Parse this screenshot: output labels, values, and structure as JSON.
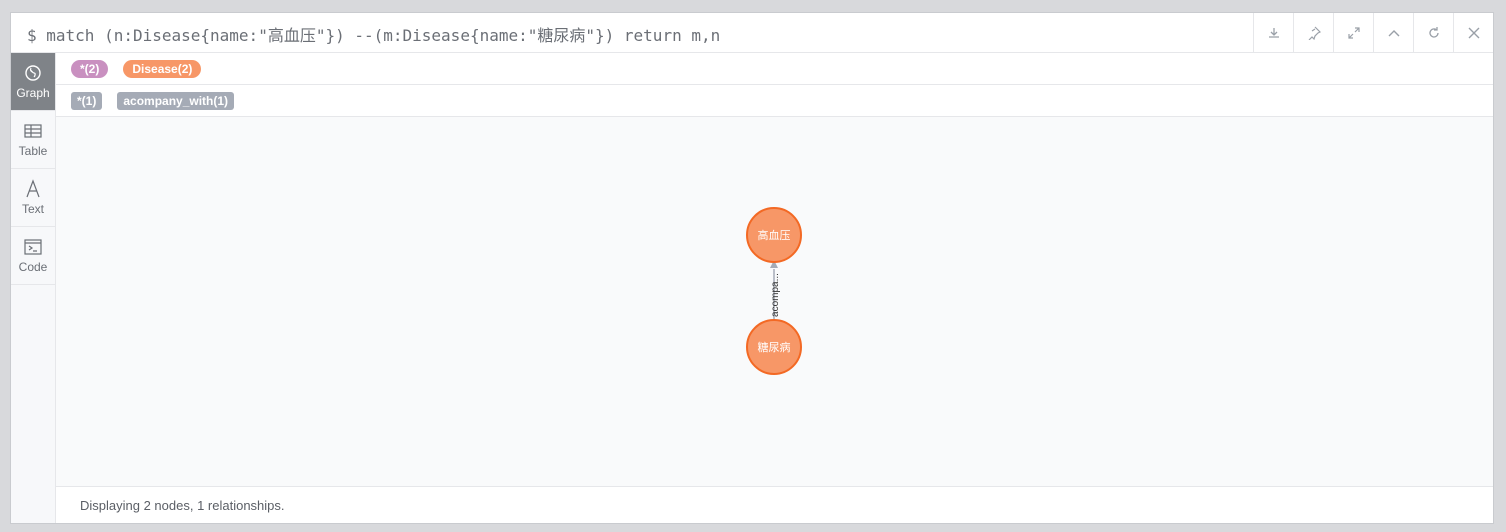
{
  "command": {
    "text": "$ match (n:Disease{name:\"高血压\"}) --(m:Disease{name:\"糖尿病\"}) return m,n"
  },
  "toolbar": {
    "icons": [
      "download-icon",
      "pin-icon",
      "expand-icon",
      "collapse-up-icon",
      "refresh-icon",
      "close-icon"
    ]
  },
  "sidenav": {
    "items": [
      {
        "label": "Graph",
        "icon": "graph-icon",
        "active": true
      },
      {
        "label": "Table",
        "icon": "table-icon",
        "active": false
      },
      {
        "label": "Text",
        "icon": "text-icon",
        "active": false
      },
      {
        "label": "Code",
        "icon": "code-icon",
        "active": false
      }
    ]
  },
  "labels": {
    "all": "*(2)",
    "disease": "Disease(2)"
  },
  "relationships": {
    "all": "*(1)",
    "acompany": "acompany_with(1)"
  },
  "graph": {
    "nodes": [
      {
        "name": "高血压",
        "label": "Disease"
      },
      {
        "name": "糖尿病",
        "label": "Disease"
      }
    ],
    "edge": {
      "label": "acompa...",
      "from": "糖尿病",
      "to": "高血压"
    }
  },
  "colors": {
    "all_label": "#c990c0",
    "disease": "#f79767",
    "disease_border": "#f36924",
    "rel_tag": "#a5abb6",
    "active_nav": "#7f8388"
  },
  "status": {
    "text": "Displaying 2 nodes, 1 relationships."
  }
}
